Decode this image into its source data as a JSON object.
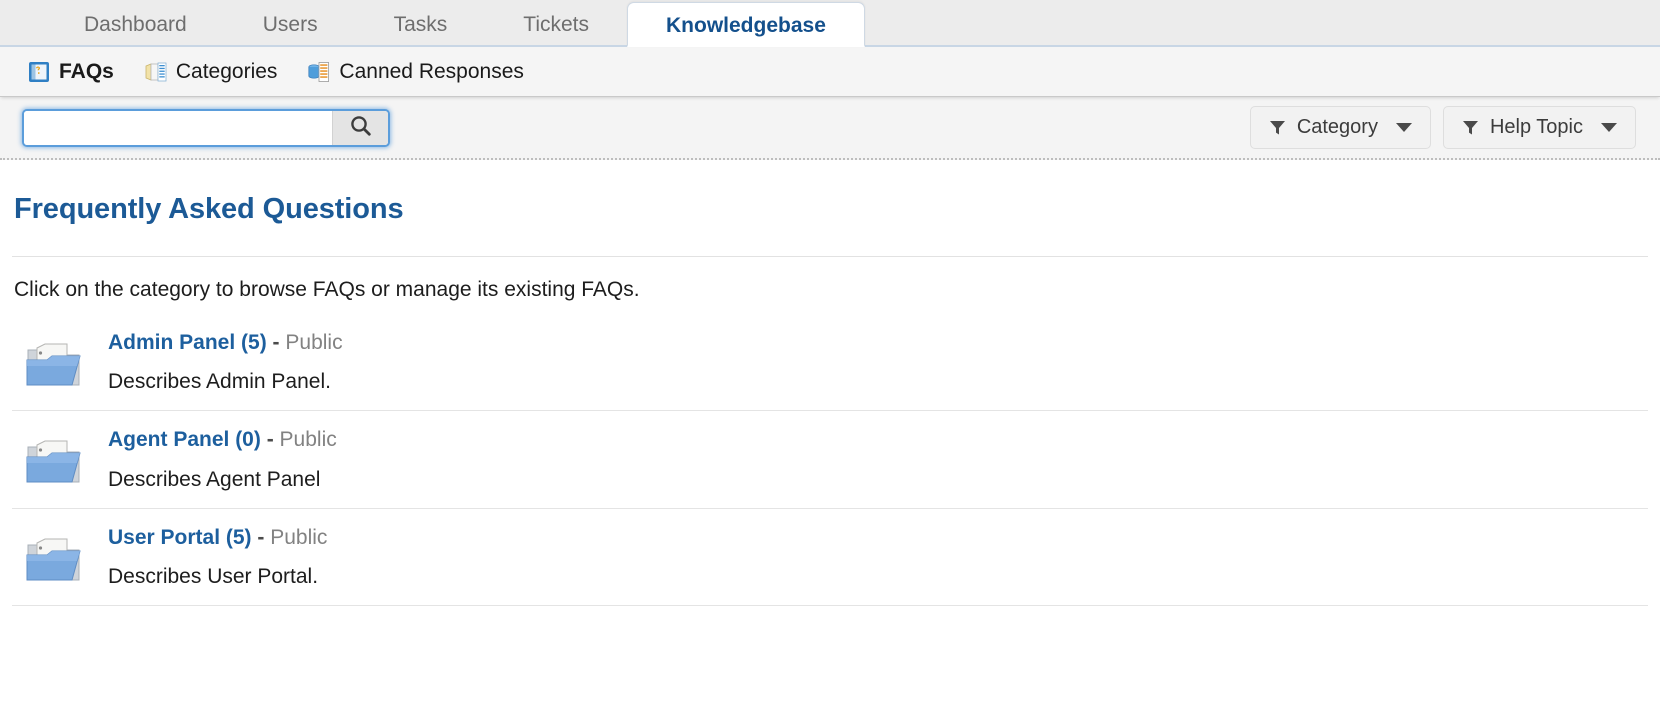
{
  "tabs": [
    {
      "label": "Dashboard",
      "active": false
    },
    {
      "label": "Users",
      "active": false
    },
    {
      "label": "Tasks",
      "active": false
    },
    {
      "label": "Tickets",
      "active": false
    },
    {
      "label": "Knowledgebase",
      "active": true
    }
  ],
  "subnav": [
    {
      "label": "FAQs",
      "icon": "faq-folder-icon",
      "current": true
    },
    {
      "label": "Categories",
      "icon": "categories-icon",
      "current": false
    },
    {
      "label": "Canned Responses",
      "icon": "canned-responses-icon",
      "current": false
    }
  ],
  "search": {
    "value": "",
    "placeholder": "",
    "button_icon": "search-icon"
  },
  "filters": [
    {
      "label": "Category",
      "icon": "filter-funnel-icon"
    },
    {
      "label": "Help Topic",
      "icon": "filter-funnel-icon"
    }
  ],
  "main": {
    "title": "Frequently Asked Questions",
    "intro": "Click on the category to browse FAQs or manage its existing FAQs.",
    "categories": [
      {
        "name": "Admin Panel (5)",
        "separator": "-",
        "visibility": "Public",
        "description": "Describes Admin Panel.",
        "icon": "open-folder-icon"
      },
      {
        "name": "Agent Panel (0)",
        "separator": "-",
        "visibility": "Public",
        "description": "Describes Agent Panel",
        "icon": "open-folder-icon"
      },
      {
        "name": "User Portal (5)",
        "separator": "-",
        "visibility": "Public",
        "description": "Describes User Portal.",
        "icon": "open-folder-icon"
      }
    ]
  },
  "colors": {
    "accent_blue": "#1c5a96",
    "link_blue": "#1d5f9e",
    "active_tab_text": "#14508c",
    "focus_blue": "#5b9ddb",
    "muted_text": "#828282"
  }
}
